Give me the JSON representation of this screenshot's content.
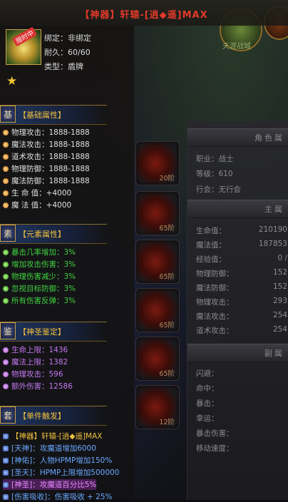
{
  "title": "【神器】轩辕-[逍◆遥]MAX",
  "item": {
    "badge": "限时中",
    "bind_label": "绑定：",
    "bind_value": "非绑定",
    "durability_label": "耐久：",
    "durability_value": "60/60",
    "type_label": "类型：",
    "type_value": "盾牌",
    "star": "★"
  },
  "sections": {
    "base": {
      "char": "基",
      "title": "【基础属性】"
    },
    "element": {
      "char": "素",
      "title": "【元素属性】"
    },
    "holy": {
      "char": "鉴",
      "title": "【神圣鉴定】"
    },
    "trigger": {
      "char": "套",
      "title": "【单件触发】"
    }
  },
  "base_stats": [
    {
      "name": "物理攻击：",
      "value": "1888-1888"
    },
    {
      "name": "魔法攻击：",
      "value": "1888-1888"
    },
    {
      "name": "道术攻击：",
      "value": "1888-1888"
    },
    {
      "name": "物理防御：",
      "value": "1888-1888"
    },
    {
      "name": "魔法防御：",
      "value": "1888-1888"
    },
    {
      "name": "生 命 值：",
      "value": "+4000"
    },
    {
      "name": "魔 法 值：",
      "value": "+4000"
    }
  ],
  "element_stats": [
    "暴击几率增加：3%",
    "增加攻击伤害：3%",
    "物理伤害减少：3%",
    "忽视目标防御：3%",
    "所有伤害反弹：3%"
  ],
  "holy_stats": [
    {
      "name": "生命上限：",
      "value": "1436"
    },
    {
      "name": "魔法上限：",
      "value": "1382"
    },
    {
      "name": "物理攻击：",
      "value": "596"
    },
    {
      "name": "额外伤害：",
      "value": "12586"
    }
  ],
  "trigger_lines": [
    "【神器】轩辕-[逍◆遥]MAX",
    "[天神]：攻魔道增加6000",
    "[神佑]：人物HPMP增加150%",
    "[圣天]：HPMP上限增加500000",
    "[神圣]：攻魔道百分比5%",
    "[伤害吸收]：伤害吸收 + 25%"
  ],
  "background": {
    "top_right_text": "天涯战城",
    "panel1_header": "角色属",
    "panel2_header": "主属",
    "panel3_header": "副属",
    "char_info": [
      {
        "label": "职业：",
        "value": "战士"
      },
      {
        "label": "等级：",
        "value": "610"
      },
      {
        "label": "行会：",
        "value": "无行会"
      }
    ],
    "main_attrs": [
      {
        "label": "生命值：",
        "value": "210190"
      },
      {
        "label": "魔法值：",
        "value": "187853"
      },
      {
        "label": "经验值：",
        "value": "0 /"
      },
      {
        "label": "物理防御：",
        "value": "152"
      },
      {
        "label": "魔法防御：",
        "value": "152"
      },
      {
        "label": "物理攻击：",
        "value": "293"
      },
      {
        "label": "魔法攻击：",
        "value": "254"
      },
      {
        "label": "道术攻击：",
        "value": "254"
      }
    ],
    "sub_attrs": [
      "闪避：",
      "命中：",
      "暴击：",
      "幸运：",
      "暴击伤害：",
      "移动速度："
    ],
    "slots": [
      "20阶",
      "65阶",
      "65阶",
      "65阶",
      "65阶",
      "12阶"
    ]
  }
}
